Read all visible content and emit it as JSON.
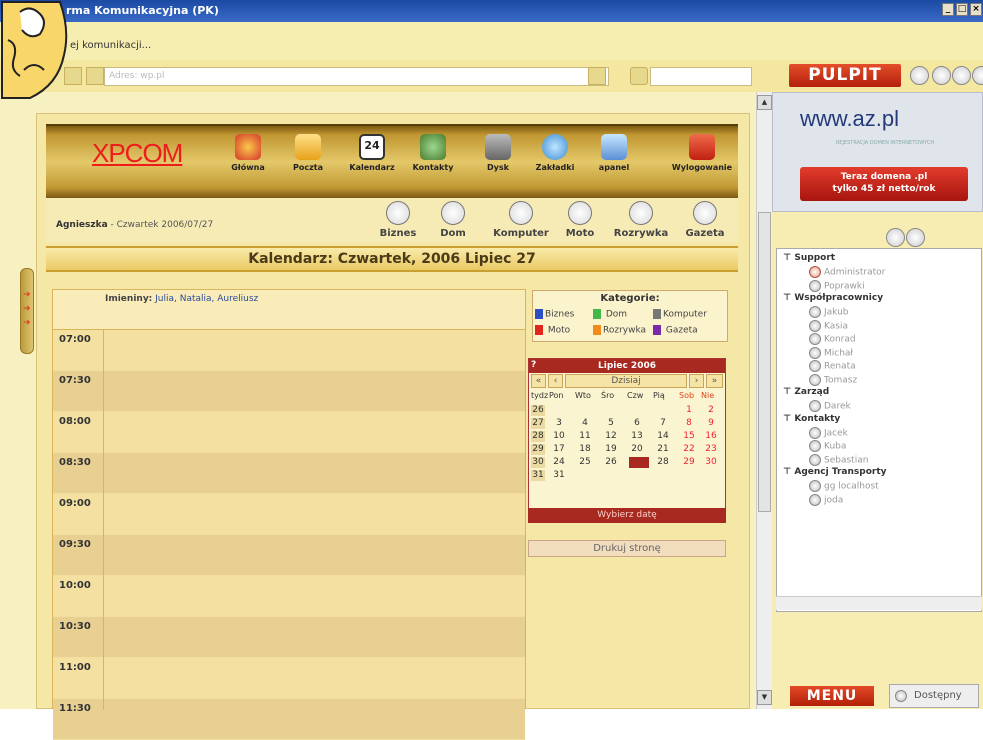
{
  "window": {
    "title": "rma Komunikacyjna (PK)",
    "buttons": [
      "_",
      "□",
      "×"
    ]
  },
  "menubar": {
    "text": "ej komunikacji..."
  },
  "addressbar": {
    "label": "Adres:",
    "value": "wp.pl",
    "search_value": ""
  },
  "pulpit": {
    "label": "PULPIT"
  },
  "app": {
    "logo": "XPCOM",
    "nav": [
      "Główna",
      "Poczta",
      "Kalendarz",
      "Kontakty",
      "Dysk",
      "Zakładki",
      "apanel",
      "Wylogowanie"
    ],
    "user": {
      "name": "Agnieszka",
      "date_text": " - Czwartek 2006/07/27"
    },
    "categories": [
      "Biznes",
      "Dom",
      "Komputer",
      "Moto",
      "Rozrywka",
      "Gazeta"
    ],
    "calendar_title": "Kalendarz: Czwartek, 2006 Lipiec 27",
    "nameday_label": "Imieniny:",
    "nameday_names": " Julia, Natalia, Aureliusz",
    "times": [
      "07:00",
      "07:30",
      "08:00",
      "08:30",
      "09:00",
      "09:30",
      "10:00",
      "10:30",
      "11:00",
      "11:30"
    ],
    "kategorie": {
      "title": "Kategorie:",
      "items": [
        {
          "label": "Biznes",
          "color": "#2e4fc1"
        },
        {
          "label": "Dom",
          "color": "#42b84a"
        },
        {
          "label": "Komputer",
          "color": "#777777"
        },
        {
          "label": "Moto",
          "color": "#e0261d"
        },
        {
          "label": "Rozrywka",
          "color": "#f28a1c"
        },
        {
          "label": "Gazeta",
          "color": "#7a2ba8"
        }
      ]
    },
    "minical": {
      "help": "?",
      "month": "Lipiec 2006",
      "nav": [
        "«",
        "‹",
        "Dzisiaj",
        "›",
        "»"
      ],
      "headers": [
        "tydz",
        "Pon",
        "Wto",
        "Śro",
        "Czw",
        "Pią",
        "Sob",
        "Nie"
      ],
      "weeks": [
        {
          "wk": "26",
          "days": [
            "",
            "",
            "",
            "",
            "",
            "1",
            "2"
          ]
        },
        {
          "wk": "27",
          "days": [
            "3",
            "4",
            "5",
            "6",
            "7",
            "8",
            "9"
          ]
        },
        {
          "wk": "28",
          "days": [
            "10",
            "11",
            "12",
            "13",
            "14",
            "15",
            "16"
          ]
        },
        {
          "wk": "29",
          "days": [
            "17",
            "18",
            "19",
            "20",
            "21",
            "22",
            "23"
          ]
        },
        {
          "wk": "30",
          "days": [
            "24",
            "25",
            "26",
            "27",
            "28",
            "29",
            "30"
          ]
        },
        {
          "wk": "31",
          "days": [
            "31",
            "",
            "",
            "",
            "",
            "",
            ""
          ]
        }
      ],
      "selected": "27",
      "button": "Wybierz datę"
    },
    "print_button": "Drukuj stronę"
  },
  "ad": {
    "url": "www.az.pl",
    "subtitle": "REJESTRACJA DOMEN INTERNETOWYCH",
    "promo_line1": "Teraz domena .pl",
    "promo_line2": "tylko 45 zł netto/rok"
  },
  "contacts": {
    "groups": [
      {
        "name": "Support",
        "members": [
          "Administrator",
          "Poprawki"
        ]
      },
      {
        "name": "Współpracownicy",
        "members": [
          "Jakub",
          "Kasia",
          "Konrad",
          "Michał",
          "Renata",
          "Tomasz"
        ]
      },
      {
        "name": "Zarząd",
        "members": [
          "Darek"
        ]
      },
      {
        "name": "Kontakty",
        "members": [
          "Jacek",
          "Kuba",
          "Sebastian"
        ]
      },
      {
        "name": "Agencj Transporty",
        "members": [
          "gg localhost",
          "joda"
        ]
      }
    ]
  },
  "bottom": {
    "menu": "MENU",
    "status": "Dostępny"
  }
}
